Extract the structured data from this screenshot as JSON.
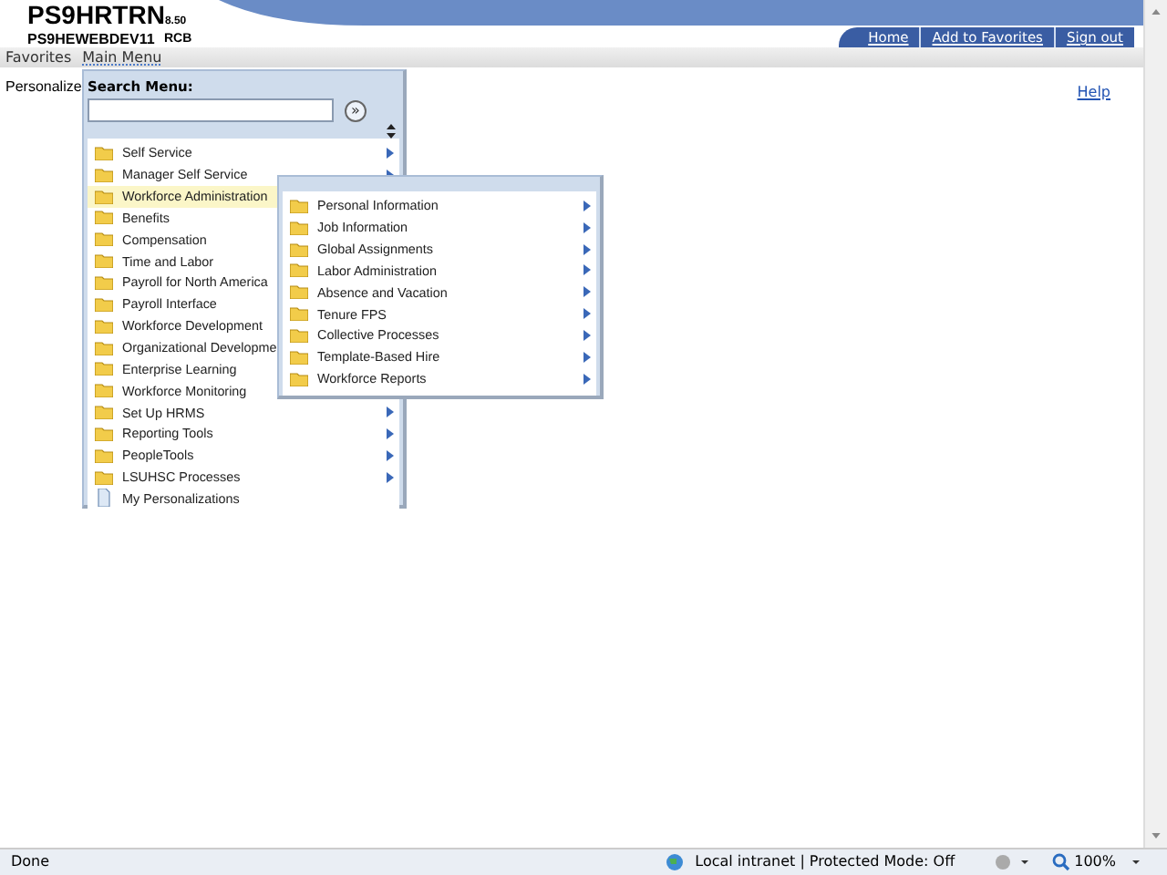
{
  "header": {
    "title": "PS9HRTRN",
    "version": "8.50",
    "server": "PS9HEWEBDEV11",
    "user": "RCB",
    "links": [
      {
        "label": "Home"
      },
      {
        "label": "Add to Favorites"
      },
      {
        "label": "Sign out"
      }
    ]
  },
  "menu_bar": [
    {
      "label": "Favorites",
      "selected": false
    },
    {
      "label": "Main Menu",
      "selected": true
    }
  ],
  "page": {
    "title": "Personalize",
    "help": "Help"
  },
  "main_menu": {
    "search_label": "Search Menu:",
    "search_button": "»",
    "items": [
      {
        "label": "Self Service",
        "kind": "folder",
        "has_submenu": true,
        "selected": false
      },
      {
        "label": "Manager Self Service",
        "kind": "folder",
        "has_submenu": true,
        "selected": false
      },
      {
        "label": "Workforce Administration",
        "kind": "folder",
        "has_submenu": false,
        "selected": true
      },
      {
        "label": "Benefits",
        "kind": "folder",
        "has_submenu": false,
        "selected": false
      },
      {
        "label": "Compensation",
        "kind": "folder",
        "has_submenu": false,
        "selected": false
      },
      {
        "label": "Time and Labor",
        "kind": "folder",
        "has_submenu": false,
        "selected": false
      },
      {
        "label": "Payroll for North America",
        "kind": "folder",
        "has_submenu": false,
        "selected": false
      },
      {
        "label": "Payroll Interface",
        "kind": "folder",
        "has_submenu": false,
        "selected": false
      },
      {
        "label": "Workforce Development",
        "kind": "folder",
        "has_submenu": false,
        "selected": false
      },
      {
        "label": "Organizational Developme",
        "kind": "folder",
        "has_submenu": false,
        "selected": false
      },
      {
        "label": "Enterprise Learning",
        "kind": "folder",
        "has_submenu": false,
        "selected": false
      },
      {
        "label": "Workforce Monitoring",
        "kind": "folder",
        "has_submenu": false,
        "selected": false
      },
      {
        "label": "Set Up HRMS",
        "kind": "folder",
        "has_submenu": true,
        "selected": false
      },
      {
        "label": "Reporting Tools",
        "kind": "folder",
        "has_submenu": true,
        "selected": false
      },
      {
        "label": "PeopleTools",
        "kind": "folder",
        "has_submenu": true,
        "selected": false
      },
      {
        "label": "LSUHSC Processes",
        "kind": "folder",
        "has_submenu": true,
        "selected": false
      },
      {
        "label": "My Personalizations",
        "kind": "page",
        "has_submenu": false,
        "selected": false
      }
    ]
  },
  "submenu": {
    "items": [
      {
        "label": "Personal Information",
        "kind": "folder",
        "has_submenu": true,
        "selected": false
      },
      {
        "label": "Job Information",
        "kind": "folder",
        "has_submenu": true,
        "selected": false
      },
      {
        "label": "Global Assignments",
        "kind": "folder",
        "has_submenu": true,
        "selected": false
      },
      {
        "label": "Labor Administration",
        "kind": "folder",
        "has_submenu": true,
        "selected": false
      },
      {
        "label": "Absence and Vacation",
        "kind": "folder",
        "has_submenu": true,
        "selected": false
      },
      {
        "label": "Tenure FPS",
        "kind": "folder",
        "has_submenu": true,
        "selected": false
      },
      {
        "label": "Collective Processes",
        "kind": "folder",
        "has_submenu": true,
        "selected": false
      },
      {
        "label": "Template-Based Hire",
        "kind": "folder",
        "has_submenu": true,
        "selected": false
      },
      {
        "label": "Workforce Reports",
        "kind": "folder",
        "has_submenu": true,
        "selected": false
      }
    ]
  },
  "status_bar": {
    "status": "Done",
    "zone": "Local intranet | Protected Mode: Off",
    "zoom": "100%"
  }
}
